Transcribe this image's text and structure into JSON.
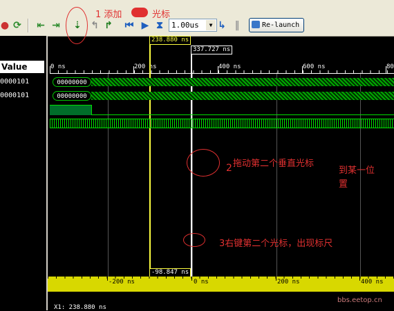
{
  "toolbar": {
    "zoom_value": "1.00us",
    "relaunch_label": "Re-launch"
  },
  "annotations": {
    "a1": "1 添加",
    "a1b": "光标",
    "a2_num": "2",
    "a2_text": "拖动第二个垂直光标",
    "a2_text2": "到某一位",
    "a2_text3": "置",
    "a3": "3右键第二个光标，出现标尺"
  },
  "left_panel": {
    "value_header": "Value",
    "values": [
      "0000101",
      "0000101"
    ]
  },
  "ruler": {
    "labels": [
      "0 ns",
      "200 ns",
      "400 ns",
      "600 ns",
      "80"
    ]
  },
  "markers": {
    "cursor1": "238.880 ns",
    "cursor2": "337.727 ns",
    "delta": "-98.847 ns"
  },
  "waves": {
    "bus1": "00000000",
    "bus2": "00000000"
  },
  "delta_ruler": {
    "labels": [
      "-200 ns",
      "0 ns",
      "200 ns",
      "400 ns"
    ]
  },
  "status": {
    "x1": "X1: 238.880 ns"
  },
  "watermark": "bbs.eetop.cn",
  "colors": {
    "cursor1": "#ffff40",
    "cursor2": "#ffffff",
    "wave": "#00e000",
    "annotation": "#e03030",
    "ruler_bar": "#d8d800"
  }
}
